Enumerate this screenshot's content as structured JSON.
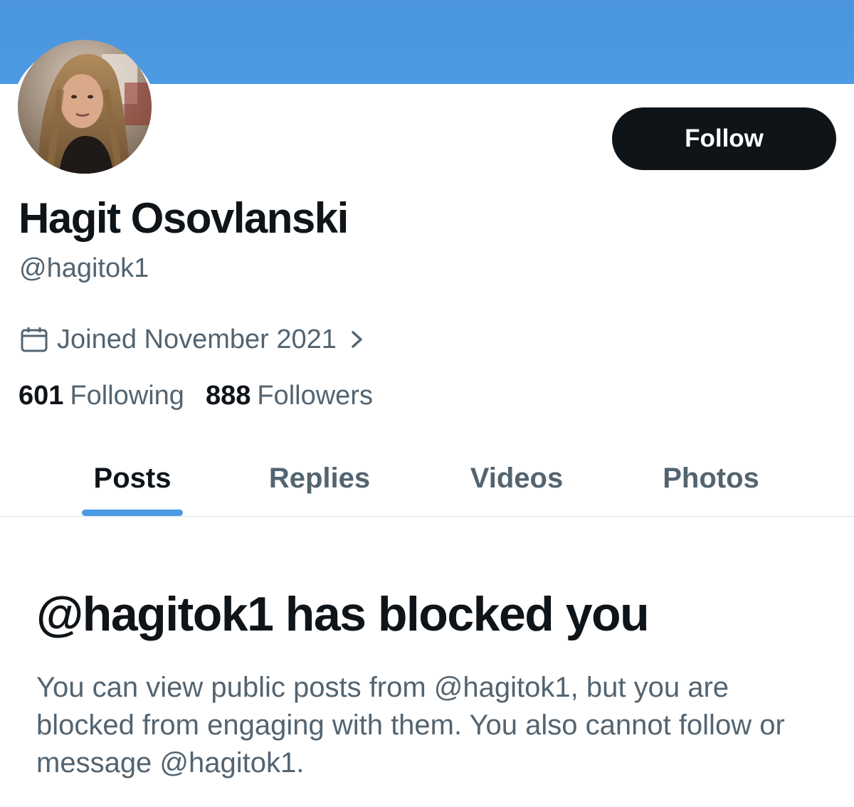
{
  "profile": {
    "display_name": "Hagit Osovlanski",
    "handle": "@hagitok1",
    "joined": "Joined November 2021",
    "following_count": "601",
    "following_label": "Following",
    "followers_count": "888",
    "followers_label": "Followers"
  },
  "actions": {
    "follow_label": "Follow"
  },
  "tabs": [
    {
      "label": "Posts",
      "active": true
    },
    {
      "label": "Replies",
      "active": false
    },
    {
      "label": "Videos",
      "active": false
    },
    {
      "label": "Photos",
      "active": false
    }
  ],
  "blocked_notice": {
    "title": "@hagitok1 has blocked you",
    "description": "You can view public posts from @hagitok1, but you are blocked from engaging with them. You also cannot follow or message @hagitok1."
  },
  "icons": {
    "joined": "calendar-icon",
    "joined_more": "chevron-right-icon"
  },
  "colors": {
    "banner": "#4c9ae3",
    "accent": "#4c9ae3",
    "primary_text": "#0f1419",
    "secondary_text": "#536471",
    "follow_button": "#0f1419"
  }
}
